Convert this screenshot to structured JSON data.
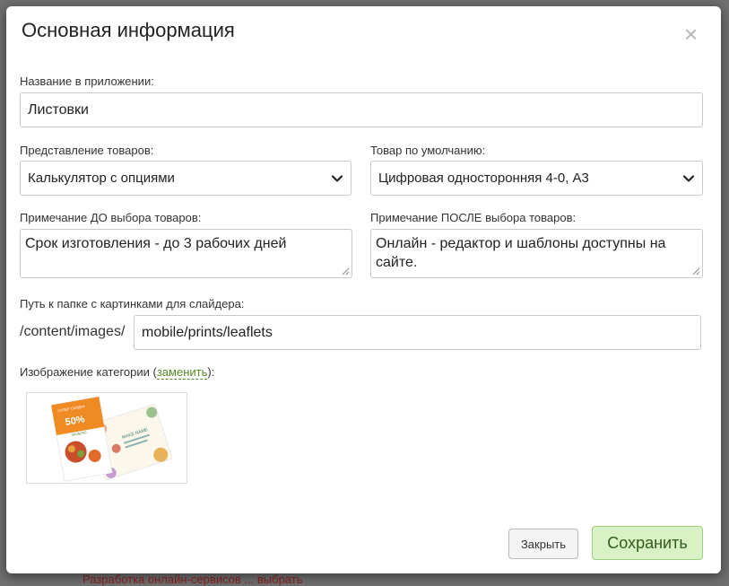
{
  "backdrop": {
    "text": "Разработка онлайн-сервисов ... выбрать"
  },
  "modal": {
    "title": "Основная информация",
    "close_symbol": "×"
  },
  "fields": {
    "app_name": {
      "label": "Название в приложении:",
      "value": "Листовки"
    },
    "product_view": {
      "label": "Представление товаров:",
      "value": "Калькулятор с опциями"
    },
    "default_product": {
      "label": "Товар по умолчанию:",
      "value": "Цифровая односторонняя 4-0, А3"
    },
    "note_before": {
      "label": "Примечание ДО выбора товаров:",
      "value": "Срок изготовления - до 3 рабочих дней"
    },
    "note_after": {
      "label": "Примечание ПОСЛЕ выбора товаров:",
      "value": "Онлайн - редактор и шаблоны доступны на сайте."
    },
    "slider_path": {
      "label": "Путь к папке с картинками для слайдера:",
      "prefix": "/content/images/",
      "value": "mobile/prints/leaflets"
    },
    "category_image": {
      "label_before": "Изображение категории (",
      "link": "заменить",
      "label_after": "):"
    }
  },
  "thumbnail": {
    "flyer_left_title": "СУПЕР СКИДКИ",
    "flyer_left_percent": "50%",
    "flyer_left_brand": "ЭКОБЛЮ",
    "flyer_right_title": "MAKE NAME"
  },
  "buttons": {
    "close": "Закрыть",
    "save": "Сохранить"
  },
  "colors": {
    "save_bg": "#d8f2c5",
    "link": "#5a8a2a",
    "backdrop": "#6f6f6f"
  }
}
